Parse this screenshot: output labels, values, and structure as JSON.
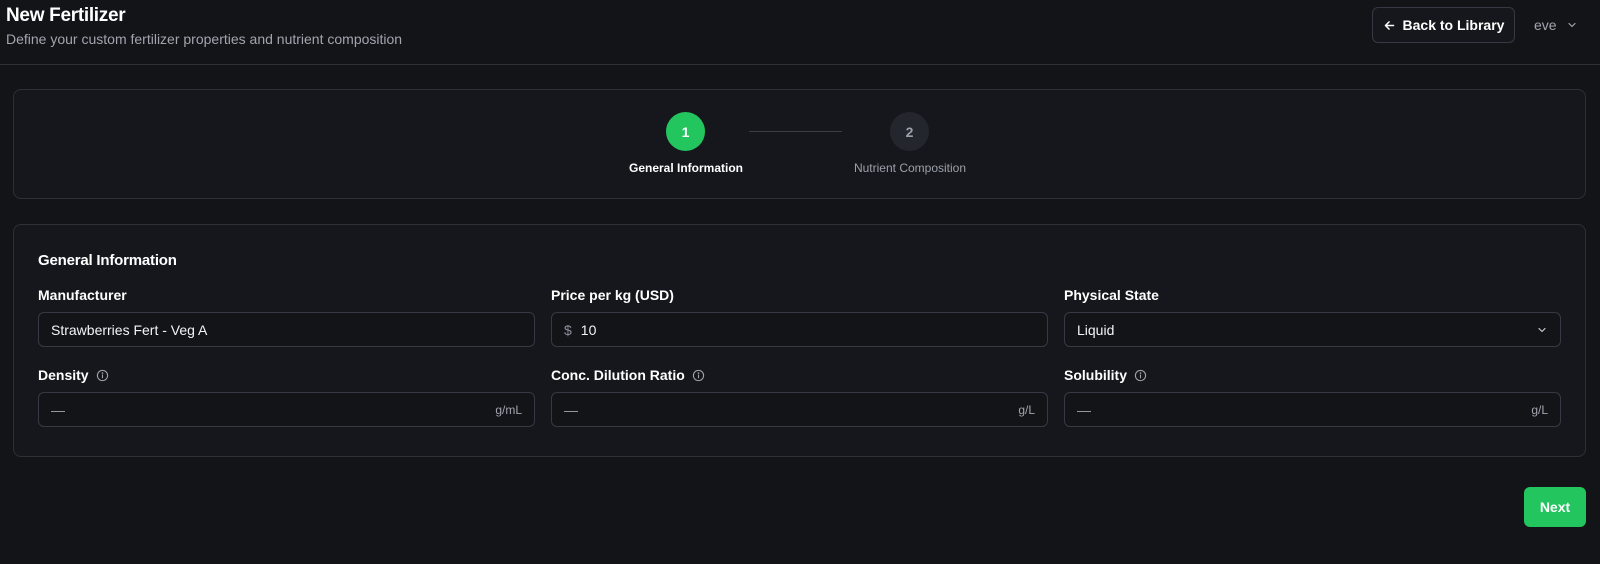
{
  "header": {
    "title": "New Fertilizer",
    "subtitle": "Define your custom fertilizer properties and nutrient composition",
    "back_label": "Back to Library",
    "user_name": "eve"
  },
  "stepper": {
    "steps": [
      {
        "number": "1",
        "label": "General Information",
        "state": "active"
      },
      {
        "number": "2",
        "label": "Nutrient Composition",
        "state": "inactive"
      }
    ]
  },
  "form": {
    "section_title": "General Information",
    "manufacturer": {
      "label": "Manufacturer",
      "value": "Strawberries Fert - Veg A"
    },
    "price": {
      "label": "Price per kg (USD)",
      "prefix": "$",
      "value": "10"
    },
    "physical_state": {
      "label": "Physical State",
      "value": "Liquid"
    },
    "density": {
      "label": "Density",
      "placeholder": "—",
      "unit": "g/mL"
    },
    "dilution": {
      "label": "Conc. Dilution Ratio",
      "placeholder": "—",
      "unit": "g/L"
    },
    "solubility": {
      "label": "Solubility",
      "placeholder": "—",
      "unit": "g/L"
    }
  },
  "actions": {
    "next_label": "Next"
  },
  "colors": {
    "accent": "#22c55e",
    "background": "#131418",
    "surface": "#16171c",
    "border": "#2e3038",
    "muted_text": "#a1a5ae"
  },
  "icons": {
    "back": "arrow-left-icon",
    "user_menu": "chevron-down-icon",
    "select": "chevron-down-icon",
    "info": "info-icon"
  }
}
